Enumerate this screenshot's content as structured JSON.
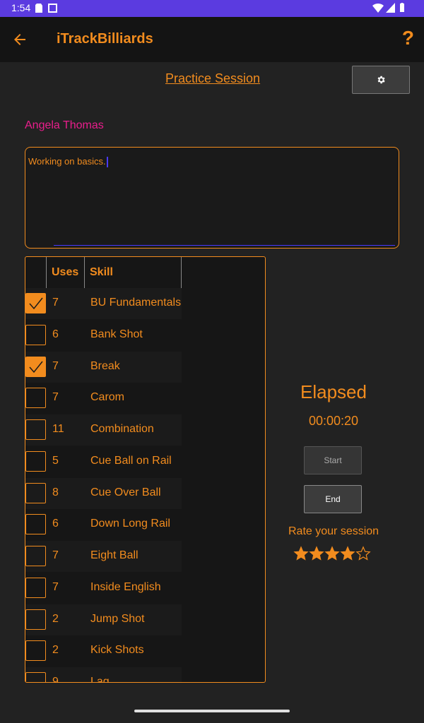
{
  "status_bar": {
    "time": "1:54"
  },
  "app_bar": {
    "title": "iTrackBilliards",
    "help": "?"
  },
  "session": {
    "title": "Practice Session"
  },
  "student": {
    "name": "Angela Thomas"
  },
  "notes": {
    "value": "Working on basics."
  },
  "skills_table": {
    "headers": {
      "uses": "Uses",
      "skill": "Skill"
    },
    "rows": [
      {
        "checked": true,
        "uses": "7",
        "skill": "BU Fundamentals"
      },
      {
        "checked": false,
        "uses": "6",
        "skill": "Bank Shot"
      },
      {
        "checked": true,
        "uses": "7",
        "skill": "Break"
      },
      {
        "checked": false,
        "uses": "7",
        "skill": "Carom"
      },
      {
        "checked": false,
        "uses": "11",
        "skill": "Combination"
      },
      {
        "checked": false,
        "uses": "5",
        "skill": "Cue Ball on Rail"
      },
      {
        "checked": false,
        "uses": "8",
        "skill": "Cue Over Ball"
      },
      {
        "checked": false,
        "uses": "6",
        "skill": "Down Long Rail"
      },
      {
        "checked": false,
        "uses": "7",
        "skill": "Eight Ball"
      },
      {
        "checked": false,
        "uses": "7",
        "skill": "Inside English"
      },
      {
        "checked": false,
        "uses": "2",
        "skill": "Jump Shot"
      },
      {
        "checked": false,
        "uses": "2",
        "skill": "Kick Shots"
      },
      {
        "checked": false,
        "uses": "9",
        "skill": "Lag"
      }
    ]
  },
  "timer": {
    "label": "Elapsed",
    "value": "00:00:20",
    "start_label": "Start",
    "end_label": "End"
  },
  "rating": {
    "label": "Rate your session",
    "value": 4,
    "max": 5
  },
  "colors": {
    "accent": "#f28c1e",
    "name": "#e91e8c",
    "status_bar": "#5b3be0",
    "background": "#222222"
  },
  "icons": [
    "back-arrow-icon",
    "help-icon",
    "settings-gear-icon",
    "checkmark-icon",
    "star-icon"
  ]
}
